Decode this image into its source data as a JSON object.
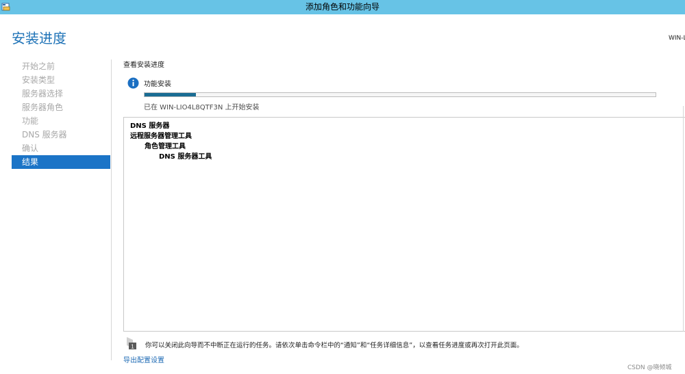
{
  "window": {
    "title": "添加角色和功能向导"
  },
  "header": {
    "page_title": "安装进度",
    "server_name": "WIN-L"
  },
  "sidebar": {
    "items": [
      {
        "label": "开始之前",
        "active": false
      },
      {
        "label": "安装类型",
        "active": false
      },
      {
        "label": "服务器选择",
        "active": false
      },
      {
        "label": "服务器角色",
        "active": false
      },
      {
        "label": "功能",
        "active": false
      },
      {
        "label": "DNS 服务器",
        "active": false
      },
      {
        "label": "确认",
        "active": false
      },
      {
        "label": "结果",
        "active": true
      }
    ]
  },
  "main": {
    "heading": "查看安装进度",
    "feature_label": "功能安装",
    "progress": 0.1,
    "status": "已在 WIN-LIO4L8QTF3N 上开始安装",
    "results": [
      {
        "label": "DNS 服务器",
        "level": 0
      },
      {
        "label": "远程服务器管理工具",
        "level": 0
      },
      {
        "label": "角色管理工具",
        "level": 1
      },
      {
        "label": "DNS 服务器工具",
        "level": 2
      }
    ],
    "note": "你可以关闭此向导而不中断正在运行的任务。请依次单击命令栏中的“通知”和“任务详细信息”，以查看任务进度或再次打开此页面。",
    "export_link": "导出配置设置"
  },
  "watermark": "CSDN @晓倾城",
  "colors": {
    "titlebar": "#67c3e6",
    "accent": "#1b74c7",
    "progress": "#1a6c93"
  },
  "icons": {
    "app": "wizard-app-icon",
    "info": "info-icon",
    "note": "flag-icon"
  }
}
